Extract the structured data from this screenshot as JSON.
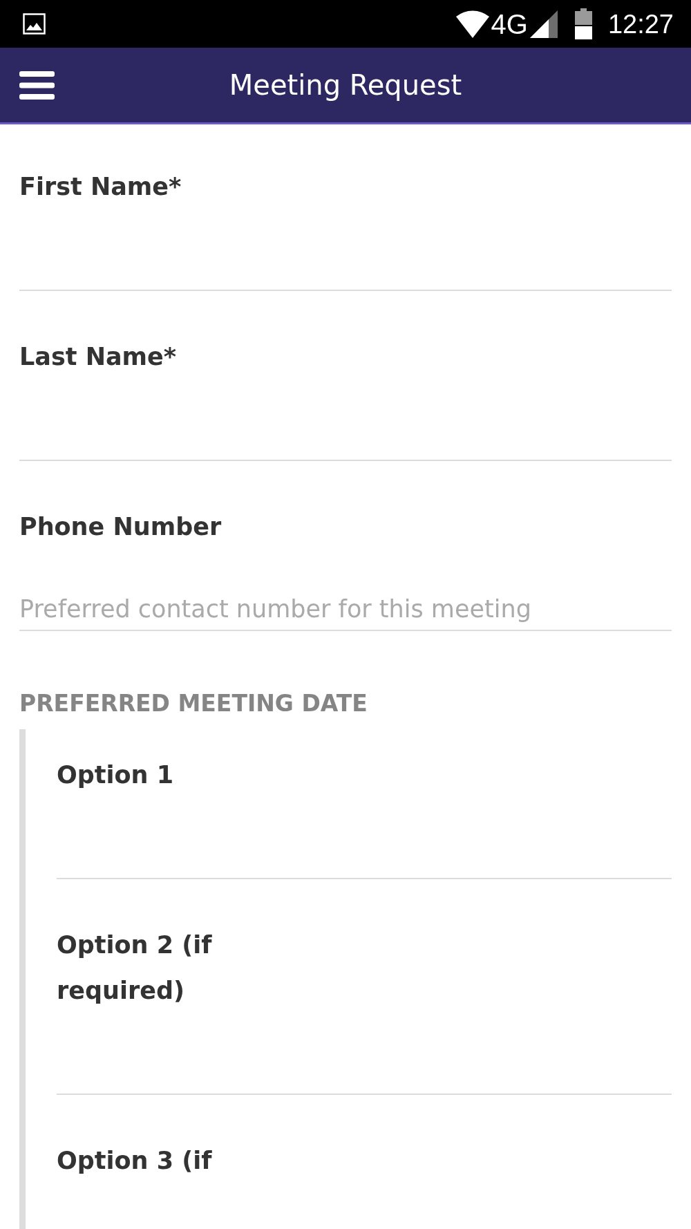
{
  "status_bar": {
    "network_type": "4G",
    "time": "12:27"
  },
  "app_bar": {
    "title": "Meeting Request"
  },
  "form": {
    "fields": [
      {
        "kind": "text",
        "label": "First Name*"
      },
      {
        "kind": "text",
        "label": "Last Name*"
      },
      {
        "kind": "text",
        "label": "Phone Number",
        "placeholder": "Preferred contact number for this meeting"
      }
    ],
    "sections": [
      {
        "heading": "PREFERRED MEETING DATE",
        "fields": [
          {
            "kind": "text",
            "label": "Option 1"
          },
          {
            "kind": "text",
            "label": "Option 2 (if required)"
          },
          {
            "kind": "label",
            "label": "Option 3 (if"
          }
        ]
      }
    ]
  }
}
